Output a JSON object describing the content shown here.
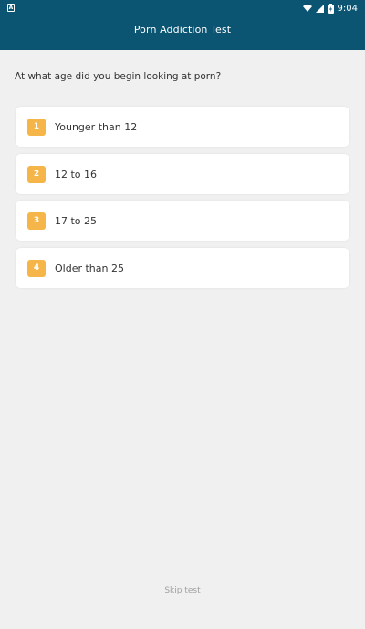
{
  "status_bar": {
    "time": "9:04",
    "left_icon": "notification-icon",
    "right_icons": [
      "wifi-icon",
      "signal-icon",
      "battery-icon"
    ]
  },
  "app_bar": {
    "title": "Porn Addiction Test"
  },
  "question": {
    "text": "At what age did you begin looking at porn?"
  },
  "options": [
    {
      "number": "1",
      "label": "Younger than 12"
    },
    {
      "number": "2",
      "label": "12 to 16"
    },
    {
      "number": "3",
      "label": "17 to 25"
    },
    {
      "number": "4",
      "label": "Older than 25"
    }
  ],
  "footer": {
    "skip_label": "Skip test"
  },
  "colors": {
    "app_bar": "#0b5472",
    "badge": "#f5b548",
    "background": "#f0f0f0"
  }
}
